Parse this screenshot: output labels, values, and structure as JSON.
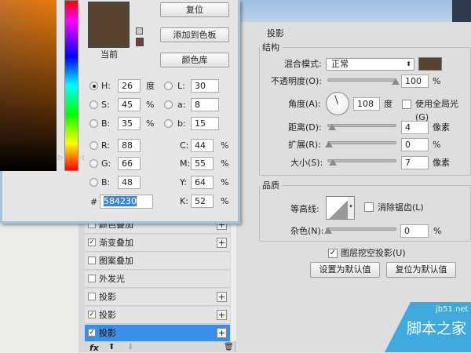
{
  "color_picker": {
    "current_label": "当前",
    "current_color": "#584230",
    "buttons": {
      "reset": "复位",
      "add_to_swatches": "添加到色板",
      "color_libraries": "颜色库"
    },
    "fields": {
      "H": {
        "label": "H:",
        "value": "26",
        "unit": "度"
      },
      "S": {
        "label": "S:",
        "value": "45",
        "unit": "%"
      },
      "Bv": {
        "label": "B:",
        "value": "35",
        "unit": "%"
      },
      "R": {
        "label": "R:",
        "value": "88"
      },
      "G": {
        "label": "G:",
        "value": "66"
      },
      "B": {
        "label": "B:",
        "value": "48"
      },
      "L": {
        "label": "L:",
        "value": "30"
      },
      "a": {
        "label": "a:",
        "value": "8"
      },
      "b": {
        "label": "b:",
        "value": "15"
      },
      "C": {
        "label": "C:",
        "value": "44",
        "unit": "%"
      },
      "M": {
        "label": "M:",
        "value": "55",
        "unit": "%"
      },
      "Y": {
        "label": "Y:",
        "value": "64",
        "unit": "%"
      },
      "K": {
        "label": "K:",
        "value": "52",
        "unit": "%"
      }
    },
    "hex_label": "#",
    "hex_value": "584230"
  },
  "effects_list": [
    {
      "label": "颜色叠加",
      "checked": false,
      "plus": true
    },
    {
      "label": "渐变叠加",
      "checked": true,
      "plus": true
    },
    {
      "label": "图案叠加",
      "checked": false,
      "plus": false
    },
    {
      "label": "外发光",
      "checked": false,
      "plus": false
    },
    {
      "label": "投影",
      "checked": false,
      "plus": true
    },
    {
      "label": "投影",
      "checked": true,
      "plus": true
    },
    {
      "label": "投影",
      "checked": true,
      "plus": true,
      "selected": true
    }
  ],
  "effects_footer": {
    "fx": "fx",
    "up": "⬆",
    "down": "⬇",
    "trash": "🗑"
  },
  "drop_shadow": {
    "title": "投影",
    "structure": {
      "legend": "结构",
      "blend_mode_label": "混合模式:",
      "blend_mode_value": "正常",
      "color": "#584230",
      "opacity_label": "不透明度(O):",
      "opacity_value": "100",
      "opacity_unit": "%",
      "angle_label": "角度(A):",
      "angle_value": "108",
      "angle_unit": "度",
      "global_light_label": "使用全局光(G)",
      "global_light_checked": false,
      "distance_label": "距离(D):",
      "distance_value": "4",
      "distance_unit": "像素",
      "spread_label": "扩展(R):",
      "spread_value": "0",
      "spread_unit": "%",
      "size_label": "大小(S):",
      "size_value": "7",
      "size_unit": "像素"
    },
    "quality": {
      "legend": "品质",
      "contour_label": "等高线:",
      "anti_alias_label": "消除锯齿(L)",
      "anti_alias_checked": false,
      "noise_label": "杂色(N):",
      "noise_value": "0",
      "noise_unit": "%"
    },
    "knockout_label": "图层挖空投影(U)",
    "knockout_checked": true,
    "make_default": "设置为默认值",
    "reset_default": "复位为默认值"
  },
  "watermark": {
    "url": "jb51.net",
    "name": "脚本之家"
  }
}
